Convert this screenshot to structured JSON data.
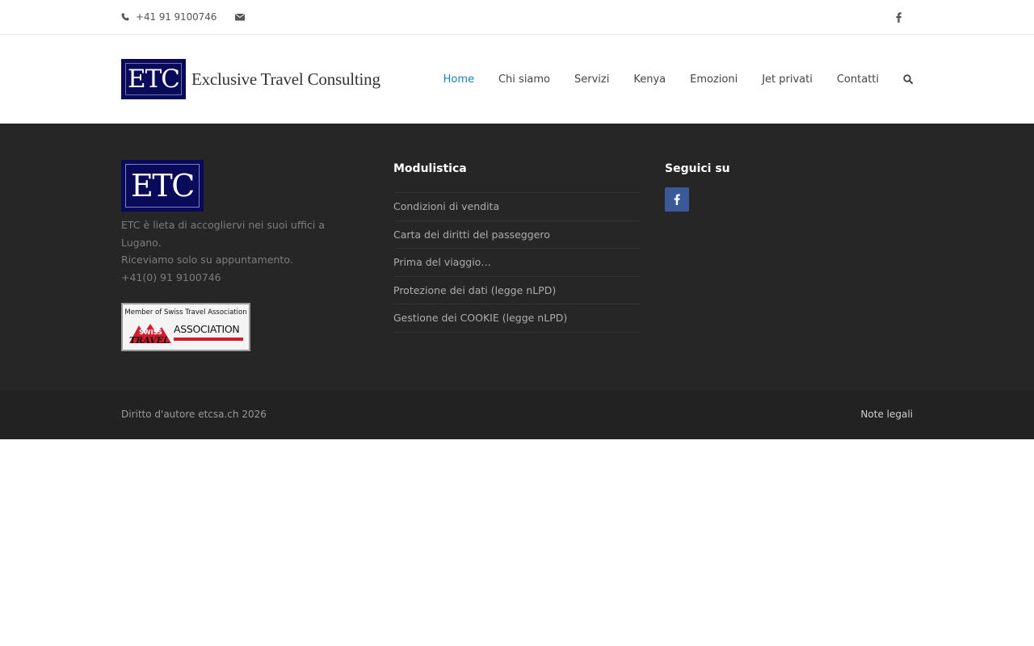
{
  "topbar": {
    "phone": "+41 91 9100746",
    "phone_icon": "phone-icon",
    "mail_icon": "envelope-icon",
    "social_icon": "facebook-icon"
  },
  "header": {
    "logo_mark": "ETC",
    "logo_text": "Exclusive Travel Consulting",
    "logo_color": "#0a0a5a",
    "nav": [
      {
        "label": "Home",
        "active": true
      },
      {
        "label": "Chi siamo"
      },
      {
        "label": "Servizi"
      },
      {
        "label": "Kenya"
      },
      {
        "label": "Emozioni"
      },
      {
        "label": "Jet privati"
      },
      {
        "label": "Contatti"
      }
    ],
    "search_icon": "search-icon",
    "active_color": "#1a7cc1"
  },
  "footer": {
    "about": {
      "logo_mark": "ETC",
      "lines": [
        "ETC è lieta di accogliervi nei suoi uffici a Lugano.",
        "Riceviamo solo su appuntamento.",
        "+41(0) 91 9100746"
      ],
      "badge": {
        "top": "Member of Swiss Travel Association",
        "mark_line1": "SWISS",
        "mark_line2": "TRAVEL",
        "association": "ASSOCIATION"
      }
    },
    "modulistica": {
      "title": "Modulistica",
      "links": [
        "Condizioni di vendita",
        "Carta dei diritti del passeggero",
        "Prima del viaggio…",
        "Protezione dei dati (legge nLPD)",
        "Gestione dei COOKIE (legge nLPD)"
      ]
    },
    "social": {
      "title": "Seguici su",
      "icon": "facebook-icon",
      "color": "#3b5998"
    },
    "background": "#262626"
  },
  "bottom": {
    "copyright": "Diritto d'autore etcsa.ch 2026",
    "legal": "Note legali",
    "background": "#222222"
  }
}
